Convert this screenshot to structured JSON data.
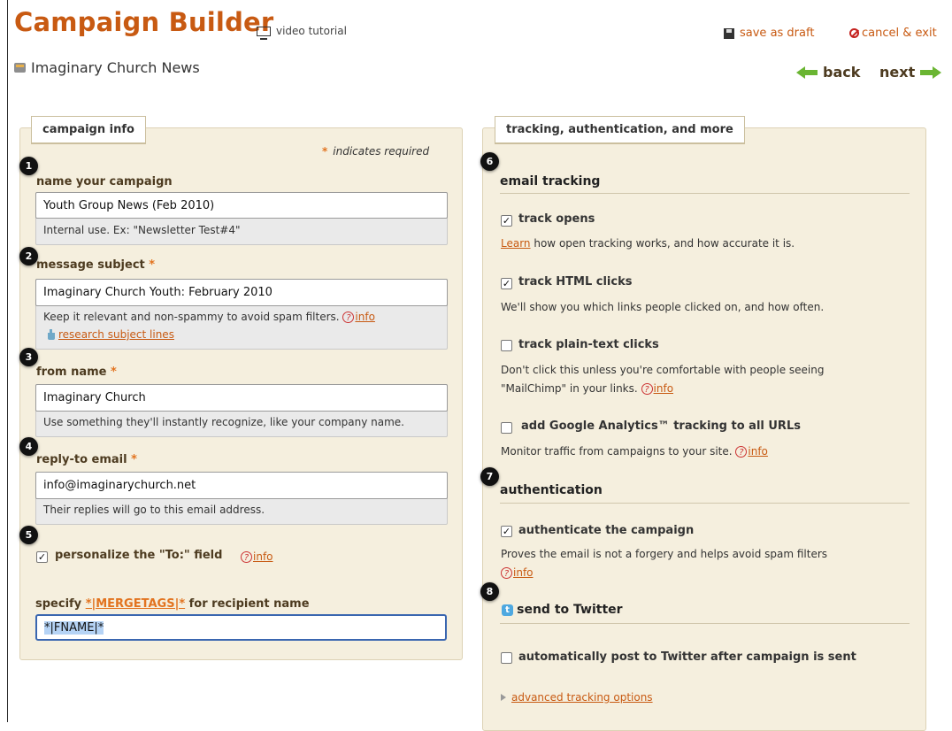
{
  "header": {
    "title": "Campaign Builder",
    "video_label": "video tutorial",
    "save_draft_label": "save as draft",
    "cancel_label": "cancel & exit",
    "campaign_name": "Imaginary Church News",
    "back_label": "back",
    "next_label": "next",
    "icons": [
      "monitor-icon",
      "save-icon",
      "cancel-icon",
      "newsletter-icon",
      "back-arrow-icon",
      "next-arrow-icon"
    ]
  },
  "campaign_info": {
    "panel_title": "campaign info",
    "required_note": "indicates required",
    "required_star": "*",
    "fields": [
      {
        "step": "1",
        "label": "name your campaign",
        "required": false,
        "value": "Youth Group News (Feb 2010)",
        "hint": "Internal use. Ex: \"Newsletter Test#4\""
      },
      {
        "step": "2",
        "label": "message subject",
        "required": true,
        "value": "Imaginary Church Youth: February 2010",
        "hint": "Keep it relevant and non-spammy to avoid spam filters.",
        "info_label": "info",
        "research_label": "research subject lines"
      },
      {
        "step": "3",
        "label": "from name",
        "required": true,
        "value": "Imaginary Church",
        "hint": "Use something they'll instantly recognize, like your company name."
      },
      {
        "step": "4",
        "label": "reply-to email",
        "required": true,
        "value": "info@imaginarychurch.net",
        "hint": "Their replies will go to this email address."
      }
    ],
    "personalize": {
      "step": "5",
      "label": "personalize the \"To:\" field",
      "checked": true,
      "info_label": "info"
    },
    "mergetags": {
      "prefix": "specify",
      "link_label": "*|MERGETAGS|*",
      "suffix": "for recipient name",
      "value": "*|FNAME|*"
    }
  },
  "tracking": {
    "panel_title": "tracking, authentication, and more",
    "email_tracking": {
      "step": "6",
      "heading": "email tracking",
      "options": [
        {
          "label": "track opens",
          "checked": true,
          "link": "Learn",
          "desc": " how open tracking works, and how accurate it is."
        },
        {
          "label": "track HTML clicks",
          "checked": true,
          "desc": "We'll show you which links people clicked on, and how often."
        },
        {
          "label": "track plain-text clicks",
          "checked": false,
          "desc1": "Don't click this unless you're comfortable with people seeing",
          "desc2": "\"MailChimp\" in your links.",
          "info_label": "info"
        },
        {
          "label": "add Google Analytics™ tracking to all URLs",
          "checked": false,
          "desc": "Monitor traffic from campaigns to your site.",
          "info_label": "info"
        }
      ]
    },
    "authentication": {
      "step": "7",
      "heading": "authentication",
      "label": "authenticate the campaign",
      "checked": true,
      "desc": "Proves the email is not a forgery and helps avoid spam filters",
      "info_label": "info"
    },
    "twitter": {
      "step": "8",
      "heading": "send to Twitter",
      "icon_letter": "t",
      "label": "automatically post to Twitter after campaign is sent",
      "checked": false
    },
    "advanced_label": "advanced tracking options"
  },
  "colors": {
    "accent": "#c85a12",
    "panel_bg": "#f5efde",
    "arrow_green": "#6ab532",
    "required": "#e2731f"
  },
  "check_glyph": "✓",
  "question_glyph": "?"
}
